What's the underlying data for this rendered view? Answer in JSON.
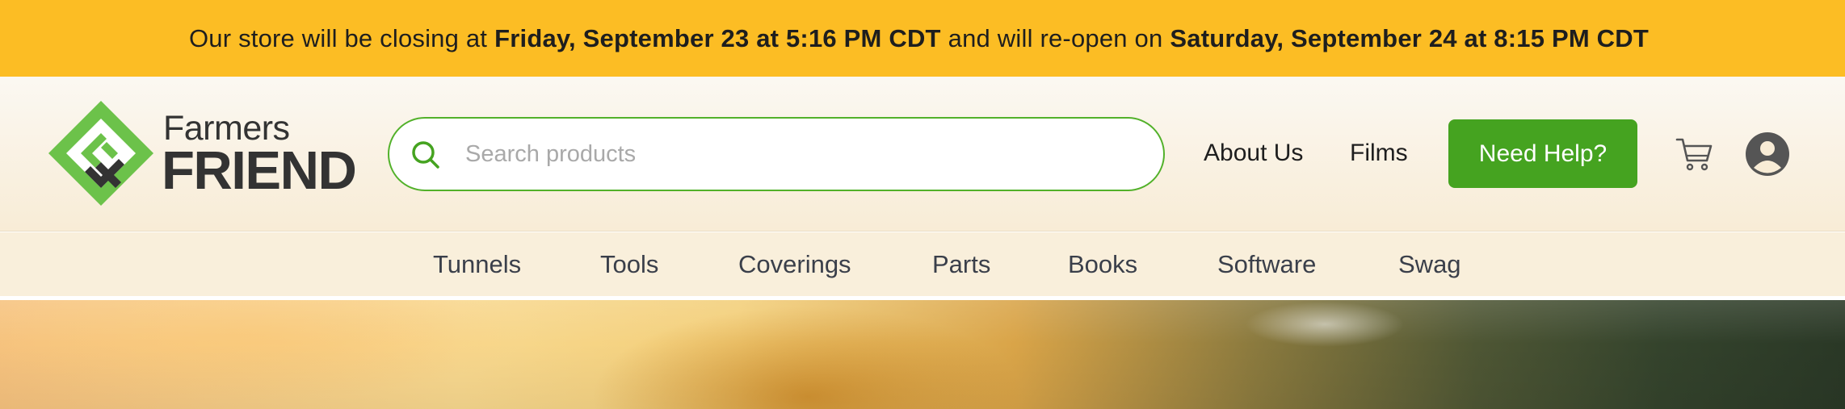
{
  "announcement": {
    "prefix": "Our store will be closing at",
    "close_time": "Friday, September 23 at 5:16 PM CDT",
    "middle": "and will re-open on",
    "reopen_time": "Saturday, September 24 at 8:15 PM CDT"
  },
  "logo": {
    "line1": "Farmers",
    "line2": "FRIEND"
  },
  "search": {
    "placeholder": "Search products",
    "value": ""
  },
  "header_nav": {
    "about": "About Us",
    "films": "Films",
    "help": "Need Help?"
  },
  "icons": {
    "search": "search-icon",
    "cart": "cart-icon",
    "account": "account-icon"
  },
  "categories": [
    "Tunnels",
    "Tools",
    "Coverings",
    "Parts",
    "Books",
    "Software",
    "Swag"
  ],
  "colors": {
    "banner": "#fcbd24",
    "brand_green": "#45a320",
    "logo_green": "#6cc24a",
    "text_dark": "#333333"
  }
}
